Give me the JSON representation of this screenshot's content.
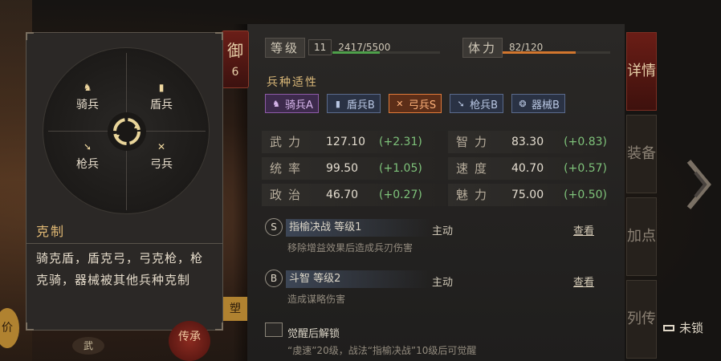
{
  "defense_tag": {
    "label": "御",
    "value": "6"
  },
  "level": {
    "label": "等级",
    "num": "11",
    "exp": "2417/5500",
    "progress": 0.44
  },
  "stamina": {
    "label": "体力",
    "value": "82/120",
    "progress": 0.68
  },
  "affinity": {
    "title": "兵种适性",
    "items": [
      {
        "label": "骑兵A",
        "icon": "horse-icon"
      },
      {
        "label": "盾兵B",
        "icon": "shield-icon"
      },
      {
        "label": "弓兵S",
        "icon": "bow-icon"
      },
      {
        "label": "枪兵B",
        "icon": "spear-icon"
      },
      {
        "label": "器械B",
        "icon": "gear-icon"
      }
    ]
  },
  "attributes": [
    {
      "name": "武力",
      "value": "127.10",
      "bonus": "(+2.31)"
    },
    {
      "name": "智力",
      "value": "83.30",
      "bonus": "(+0.83)"
    },
    {
      "name": "统率",
      "value": "99.50",
      "bonus": "(+1.05)"
    },
    {
      "name": "速度",
      "value": "40.70",
      "bonus": "(+0.57)"
    },
    {
      "name": "政治",
      "value": "46.70",
      "bonus": "(+0.27)"
    },
    {
      "name": "魅力",
      "value": "75.00",
      "bonus": "(+0.50)"
    }
  ],
  "skills": [
    {
      "badge": "S",
      "name": "指榆决战 等级1",
      "type": "主动",
      "view": "查看",
      "desc": "移除增益效果后造成兵刃伤害"
    },
    {
      "badge": "B",
      "name": "斗智 等级2",
      "type": "主动",
      "view": "查看",
      "desc": "造成谋略伤害"
    }
  ],
  "awaken": {
    "title": "觉醒后解锁",
    "desc": "“虔速”20级，战法“指榆决战”10级后可觉醒"
  },
  "tabs": [
    "详情",
    "装备",
    "加点",
    "列传"
  ],
  "unlock": "未锁",
  "tooltip": {
    "units": [
      "骑兵",
      "盾兵",
      "枪兵",
      "弓兵"
    ],
    "title": "克制",
    "text": "骑克盾，盾克弓，弓克枪，枪克骑，器械被其他兵种克制"
  },
  "decor": {
    "left": "价",
    "red": "传承",
    "gold": "塑",
    "bottom": "武"
  }
}
